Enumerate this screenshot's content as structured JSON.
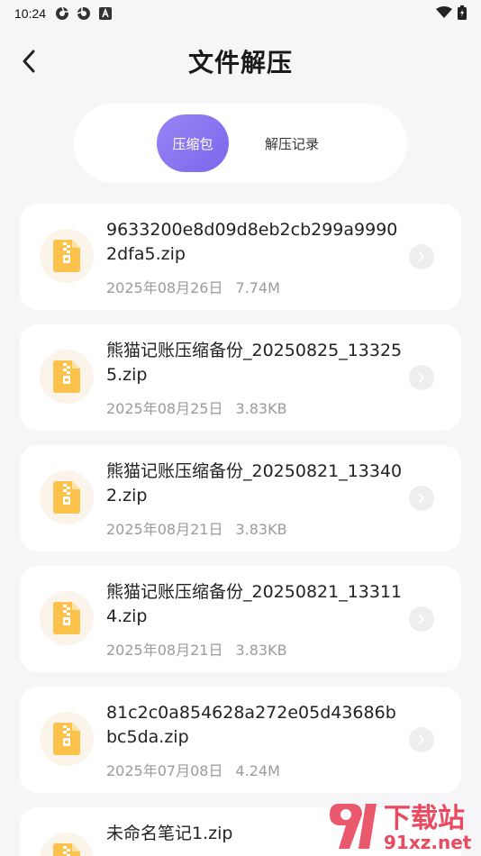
{
  "status_bar": {
    "time": "10:24"
  },
  "header": {
    "title": "文件解压"
  },
  "tabs": [
    {
      "label": "压缩包",
      "active": true
    },
    {
      "label": "解压记录",
      "active": false
    }
  ],
  "files": [
    {
      "name": "9633200e8d09d8eb2cb299a99902dfa5.zip",
      "date": "2025年08月26日",
      "size": "7.74M"
    },
    {
      "name": "熊猫记账压缩备份_20250825_133255.zip",
      "date": "2025年08月25日",
      "size": "3.83KB"
    },
    {
      "name": "熊猫记账压缩备份_20250821_133402.zip",
      "date": "2025年08月21日",
      "size": "3.83KB"
    },
    {
      "name": "熊猫记账压缩备份_20250821_133114.zip",
      "date": "2025年08月21日",
      "size": "3.83KB"
    },
    {
      "name": "81c2c0a854628a272e05d43686bbc5da.zip",
      "date": "2025年07月08日",
      "size": "4.24M"
    },
    {
      "name": "未命名笔记1.zip"
    }
  ],
  "watermark": {
    "text": "下载站",
    "domain": "91xz.net"
  },
  "colors": {
    "accent": "#8b75f0",
    "file_icon": "#fcc24b",
    "file_icon_bg": "#fbf4ea",
    "background": "#f6f6f8"
  }
}
